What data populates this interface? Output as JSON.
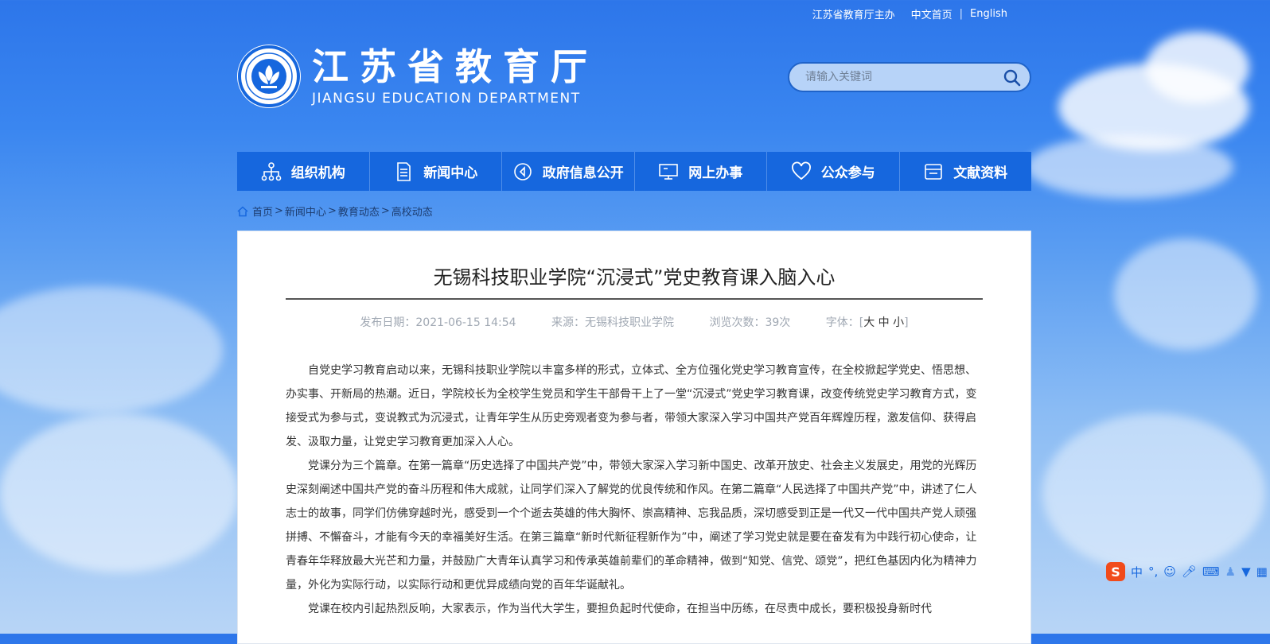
{
  "topbar": {
    "sponsor": "江苏省教育厅主办",
    "home_cn": "中文首页",
    "sep": "|",
    "english": "English"
  },
  "logo": {
    "name_cn": "江苏省教育厅",
    "name_en": "JIANGSU EDUCATION DEPARTMENT"
  },
  "search": {
    "placeholder": "请输入关键词"
  },
  "nav": {
    "items": [
      {
        "label": "组织机构",
        "icon": "org-chart-icon"
      },
      {
        "label": "新闻中心",
        "icon": "document-icon"
      },
      {
        "label": "政府信息公开",
        "icon": "announcement-icon"
      },
      {
        "label": "网上办事",
        "icon": "monitor-icon"
      },
      {
        "label": "公众参与",
        "icon": "heart-icon"
      },
      {
        "label": "文献资料",
        "icon": "archive-icon"
      }
    ]
  },
  "breadcrumb": {
    "items": [
      "首页",
      "新闻中心",
      "教育动态",
      "高校动态"
    ],
    "sep": ">"
  },
  "article": {
    "title": "无锡科技职业学院“沉浸式”党史教育课入脑入心",
    "meta": {
      "date": "发布日期：2021-06-15 14:54",
      "source": "来源：无锡科技职业学院",
      "views": "浏览次数：39次",
      "font_label": "字体：",
      "font_sizes": [
        "大",
        "中",
        "小"
      ]
    },
    "paragraphs": [
      "自党史学习教育启动以来，无锡科技职业学院以丰富多样的形式，立体式、全方位强化党史学习教育宣传，在全校掀起学党史、悟思想、办实事、开新局的热潮。近日，学院校长为全校学生党员和学生干部骨干上了一堂“沉浸式”党史学习教育课，改变传统党史学习教育方式，变接受式为参与式，变说教式为沉浸式，让青年学生从历史旁观者变为参与者，带领大家深入学习中国共产党百年辉煌历程，激发信仰、获得启发、汲取力量，让党史学习教育更加深入人心。",
      "党课分为三个篇章。在第一篇章“历史选择了中国共产党”中，带领大家深入学习新中国史、改革开放史、社会主义发展史，用党的光辉历史深刻阐述中国共产党的奋斗历程和伟大成就，让同学们深入了解党的优良传统和作风。在第二篇章“人民选择了中国共产党”中，讲述了仁人志士的故事，同学们仿佛穿越时光，感受到一个个逝去英雄的伟大胸怀、崇高精神、忘我品质，深切感受到正是一代又一代中国共产党人顽强拼搏、不懈奋斗，才能有今天的幸福美好生活。在第三篇章“新时代新征程新作为”中，阐述了学习党史就是要在奋发有为中践行初心使命，让青春年华释放最大光芒和力量，并鼓励广大青年认真学习和传承英雄前辈们的革命精神，做到“知党、信党、颂党”，把红色基因内化为精神力量，外化为实际行动，以实际行动和更优异成绩向党的百年华诞献礼。",
      "党课在校内引起热烈反响，大家表示，作为当代大学生，要担负起时代使命，在担当中历练，在尽责中成长，要积极投身新时代"
    ]
  },
  "ime": {
    "logo": "S",
    "mode": "中",
    "punct": "°,"
  }
}
